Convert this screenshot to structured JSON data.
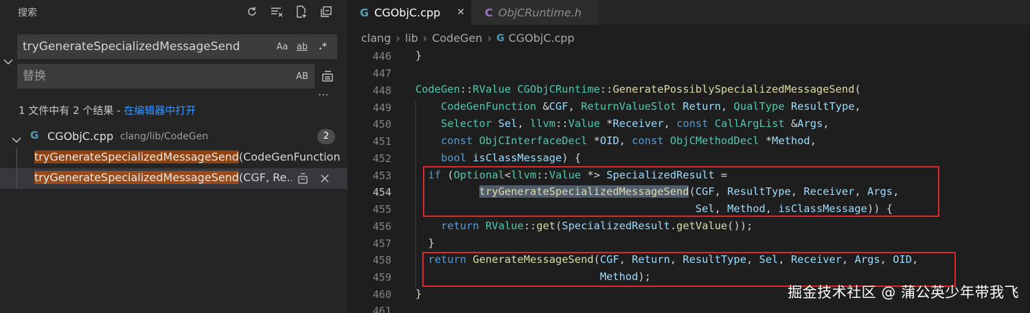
{
  "sidebar": {
    "title": "搜索",
    "search": {
      "value": "tryGenerateSpecializedMessageSend",
      "opt_case": "Aa",
      "opt_word": "ab",
      "opt_regex": ".*"
    },
    "replace": {
      "placeholder": "替换",
      "opt_preserve": "AB"
    },
    "summary_text": "1 文件中有 2 个结果 - ",
    "summary_link": "在编辑器中打开",
    "file": {
      "name": "CGObjC.cpp",
      "path": "clang/lib/CodeGen",
      "count": "2"
    },
    "matches": [
      {
        "hit": "tryGenerateSpecializedMessageSend",
        "rest": "(CodeGenFunction ..."
      },
      {
        "hit": "tryGenerateSpecializedMessageSend",
        "rest": "(CGF, Re..."
      }
    ]
  },
  "editor": {
    "tabs": [
      {
        "icon": "C",
        "label": "CGObjC.cpp",
        "close": "✕"
      },
      {
        "icon": "C",
        "label": "ObjCRuntime.h"
      }
    ],
    "breadcrumb": [
      "clang",
      "lib",
      "CodeGen",
      "CGObjC.cpp"
    ],
    "line_numbers": [
      "446",
      "447",
      "448",
      "449",
      "450",
      "451",
      "452",
      "453",
      "454",
      "455",
      "456",
      "457",
      "458",
      "459",
      "460",
      "461"
    ],
    "current_line": "454"
  },
  "watermark": "掘金技术社区 @ 蒲公英少年带我飞",
  "colors": {
    "accent_link": "#3794ff",
    "match_highlight": "#ea5c00",
    "annotation_box": "#e0272b",
    "keyword": "#569cd6",
    "type": "#4ec9b0",
    "function": "#dcdcaa",
    "param": "#9cdcfe"
  }
}
